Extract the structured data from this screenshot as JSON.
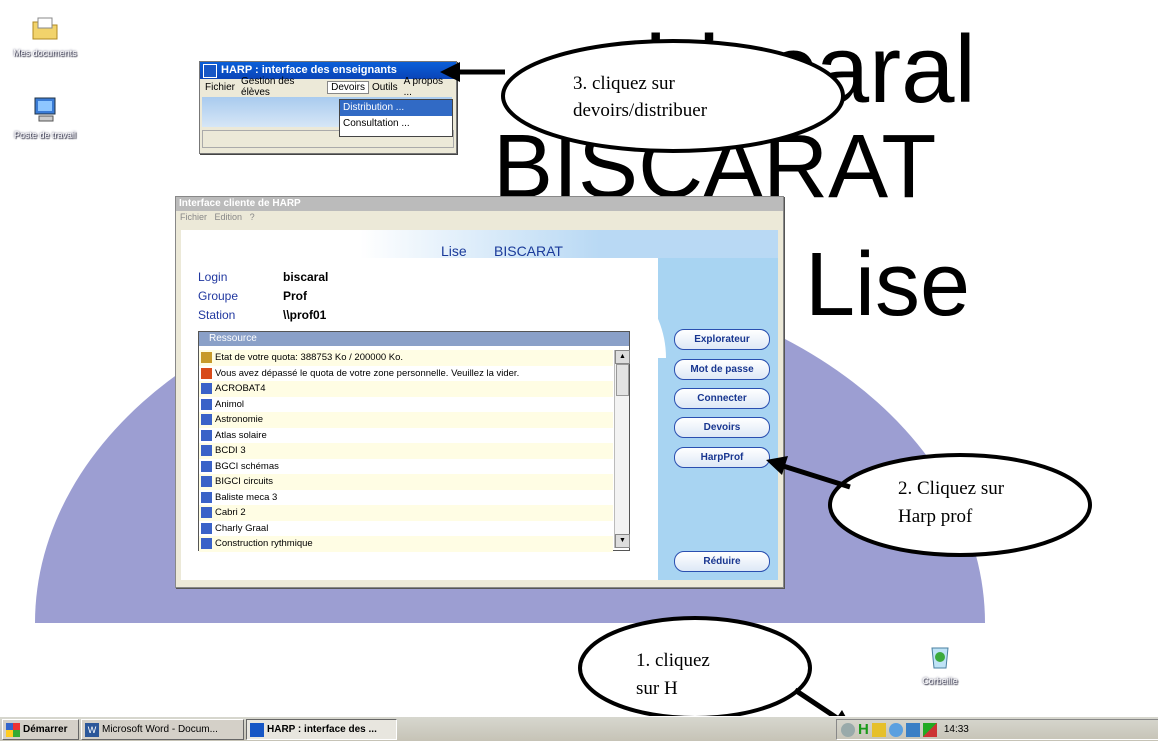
{
  "background_text": {
    "line1": "biscaral",
    "line2": "BISCARAT",
    "line3": "Lise"
  },
  "desktop": {
    "icons": [
      {
        "label": "Mes documents",
        "icon": "folder-documents-icon"
      },
      {
        "label": "Poste de travail",
        "icon": "computer-icon"
      },
      {
        "label": "Corbeille",
        "icon": "recycle-bin-icon"
      }
    ]
  },
  "harp_window": {
    "title": "HARP : interface des enseignants",
    "menu": [
      "Fichier",
      "Gestion des élèves",
      "Devoirs",
      "Outils",
      "A propos ..."
    ],
    "dropdown": [
      "Distribution ...",
      "Consultation ..."
    ]
  },
  "client_window": {
    "title": "Interface cliente de HARP",
    "menu": [
      "Fichier",
      "Edition",
      "?"
    ],
    "first_name": "Lise",
    "last_name": "BISCARAT",
    "info": [
      {
        "label": "Login",
        "value": "biscaral"
      },
      {
        "label": "Groupe",
        "value": "Prof"
      },
      {
        "label": "Station",
        "value": "\\\\prof01"
      }
    ],
    "list_header": "Ressource",
    "resources": [
      {
        "text": "Etat de votre quota: 388753 Ko / 200000 Ko.",
        "icon": "home-icon"
      },
      {
        "text": "Vous avez dépassé le quota de votre zone personnelle. Veuillez la vider.",
        "icon": "warning-home-icon"
      },
      {
        "text": "ACROBAT4",
        "icon": "app-icon"
      },
      {
        "text": "Animol",
        "icon": "app-icon"
      },
      {
        "text": "Astronomie",
        "icon": "app-icon"
      },
      {
        "text": "Atlas solaire",
        "icon": "app-icon"
      },
      {
        "text": "BCDI 3",
        "icon": "app-icon"
      },
      {
        "text": "BGCI schémas",
        "icon": "app-icon"
      },
      {
        "text": "BIGCI circuits",
        "icon": "app-icon"
      },
      {
        "text": "Baliste meca 3",
        "icon": "app-icon"
      },
      {
        "text": "Cabri 2",
        "icon": "app-icon"
      },
      {
        "text": "Charly Graal",
        "icon": "app-icon"
      },
      {
        "text": "Construction rythmique",
        "icon": "app-icon"
      }
    ],
    "buttons": [
      "Explorateur",
      "Mot de passe",
      "Connecter",
      "Devoirs",
      "HarpProf",
      "Réduire"
    ]
  },
  "callouts": {
    "step1_line1": "1. cliquez",
    "step1_line2": "sur H",
    "step2_line1": "2. Cliquez sur",
    "step2_line2": "Harp prof",
    "step3_line1": "3. cliquez sur",
    "step3_line2": "devoirs/distribuer"
  },
  "taskbar": {
    "start": "Démarrer",
    "tasks": [
      "Microsoft Word - Docum...",
      "HARP : interface des ..."
    ],
    "tray_h": "H",
    "clock": "14:33"
  }
}
